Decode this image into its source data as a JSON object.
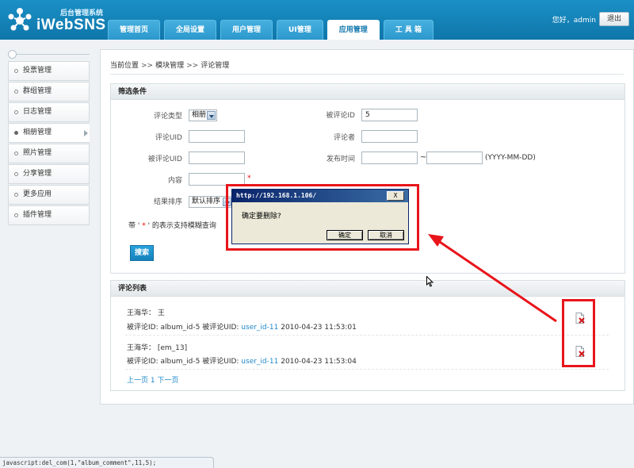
{
  "header": {
    "logo_subtitle": "后台管理系统",
    "logo_name": "iWebSNS",
    "nav_tabs": [
      {
        "label": "管理首页",
        "active": false
      },
      {
        "label": "全局设置",
        "active": false
      },
      {
        "label": "用户管理",
        "active": false
      },
      {
        "label": "UI管理",
        "active": false
      },
      {
        "label": "应用管理",
        "active": true
      },
      {
        "label": "工 具 箱",
        "active": false
      }
    ],
    "greeting": "您好，admin",
    "logout_label": "退出"
  },
  "sidebar": {
    "items": [
      {
        "label": "投票管理",
        "active": false
      },
      {
        "label": "群组管理",
        "active": false
      },
      {
        "label": "日志管理",
        "active": false
      },
      {
        "label": "相册管理",
        "active": true
      },
      {
        "label": "照片管理",
        "active": false
      },
      {
        "label": "分享管理",
        "active": false
      },
      {
        "label": "更多应用",
        "active": false
      },
      {
        "label": "插件管理",
        "active": false
      }
    ]
  },
  "breadcrumb": {
    "items": [
      "当前位置",
      "模块管理",
      "评论管理"
    ],
    "separator": ">>"
  },
  "filter": {
    "title": "筛选条件",
    "comment_type_label": "评论类型",
    "comment_type_value": "相册",
    "commented_id_label": "被评论ID",
    "commented_id_value": "5",
    "comment_uid_label": "评论UID",
    "commenter_label": "评论者",
    "commented_uid_label": "被评论UID",
    "publish_time_label": "发布时间",
    "date_range_sep": "~",
    "date_format": "(YYYY-MM-DD)",
    "content_label": "内容",
    "required_mark": "*",
    "sort_label": "结果排序",
    "sort_value": "默认排序",
    "hint_prefix": "带 '",
    "hint_star": " * ",
    "hint_suffix": "' 的表示支持模糊查询",
    "search_label": "搜索"
  },
  "comments": {
    "title": "评论列表",
    "items": [
      {
        "author_line": "王海华： 王",
        "id_prefix": "被评论ID: album_id-5 被评论UID: ",
        "uid": "user_id-11",
        "timestamp": "2010-04-23 11:53:01"
      },
      {
        "author_line": "王海华： [em_13]",
        "id_prefix": "被评论ID: album_id-5 被评论UID: ",
        "uid": "user_id-11",
        "timestamp": "2010-04-23 11:53:04"
      }
    ],
    "pager": {
      "prev": "上一页",
      "page": "1",
      "next": "下一页"
    }
  },
  "dialog": {
    "title": "http://192.168.1.106/",
    "close": "X",
    "message": "确定要删除?",
    "ok": "确定",
    "cancel": "取消"
  },
  "statusbar": {
    "text": "javascript:del_com(1,\"album_comment\",11,5);"
  },
  "colors": {
    "header_blue": "#1581bb",
    "link_blue": "#1f88c9",
    "annotation_red": "#e8151b",
    "dialog_title": "#0a246a"
  }
}
